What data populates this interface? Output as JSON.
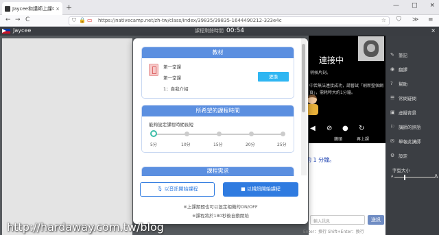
{
  "browser": {
    "tab_title": "Jaycee和講師上課中 - 黃影",
    "tab_close": "×",
    "new_tab": "+",
    "url": "https://nativecamp.net/zh-tw/class/index/39835/39835-1644490212-323e4c",
    "win_min": "—",
    "win_max": "□",
    "win_close": "×",
    "nav_back": "←",
    "nav_forward": "→",
    "nav_reload": "C"
  },
  "classbar": {
    "teacher_name": "Jaycee",
    "timer_label": "課程剩餘時間",
    "timer_value": "00:54",
    "close": "×"
  },
  "video": {
    "title": "連接中",
    "line1": "稍候片刻。",
    "line2": "中若無法連接成功，請嘗試「刷新整個網",
    "line3": "頁」，需耗時大約1分鐘。",
    "ctl_labels": [
      "",
      "",
      "鏡頭",
      "",
      "再上課"
    ]
  },
  "chat": {
    "message": "約 1 分鐘。",
    "input_placeholder": "輸入訊息",
    "send_label": "送訊",
    "hint": "Enter：換行  Shift+Enter：換行"
  },
  "sidebar": {
    "items": [
      {
        "icon": "✎",
        "label": "筆記"
      },
      {
        "icon": "◉",
        "label": "翻譯"
      },
      {
        "icon": "?",
        "label": "幫助"
      },
      {
        "icon": "☰",
        "label": "常問疑問"
      },
      {
        "icon": "▣",
        "label": "虛擬背景"
      },
      {
        "icon": "⚐",
        "label": "講師的評語"
      },
      {
        "icon": "✉",
        "label": "舉報此講師"
      },
      {
        "icon": "⚙",
        "label": "設定"
      }
    ],
    "font_size_label": "字型大小",
    "font_small": "A",
    "font_large": "A"
  },
  "modal": {
    "material": {
      "header": "教材",
      "line1": "第一堂課",
      "line2": "第一堂課",
      "line3": "1：自我介紹",
      "swap_button": "更換"
    },
    "duration": {
      "header": "所希望的課程時間",
      "subtitle": "能夠設定課程時間長短",
      "options": [
        "5分",
        "10分",
        "15分",
        "20分",
        "25分"
      ],
      "selected_index": 0
    },
    "request_header": "課程需求",
    "audio_button": "以音訊開始課程",
    "video_button": "以視訊開始課程",
    "note1": "※上課期間也可以設定相機的ON/OFF",
    "note2": "※課程將於180秒後自動開始"
  },
  "watermark": "http://hardaway.com.tw/blog",
  "colors": {
    "primary": "#2f7be0",
    "header_blue": "#5b8fe0",
    "swap_button": "#2fb6f2",
    "selected_dot": "#3cbda8"
  }
}
